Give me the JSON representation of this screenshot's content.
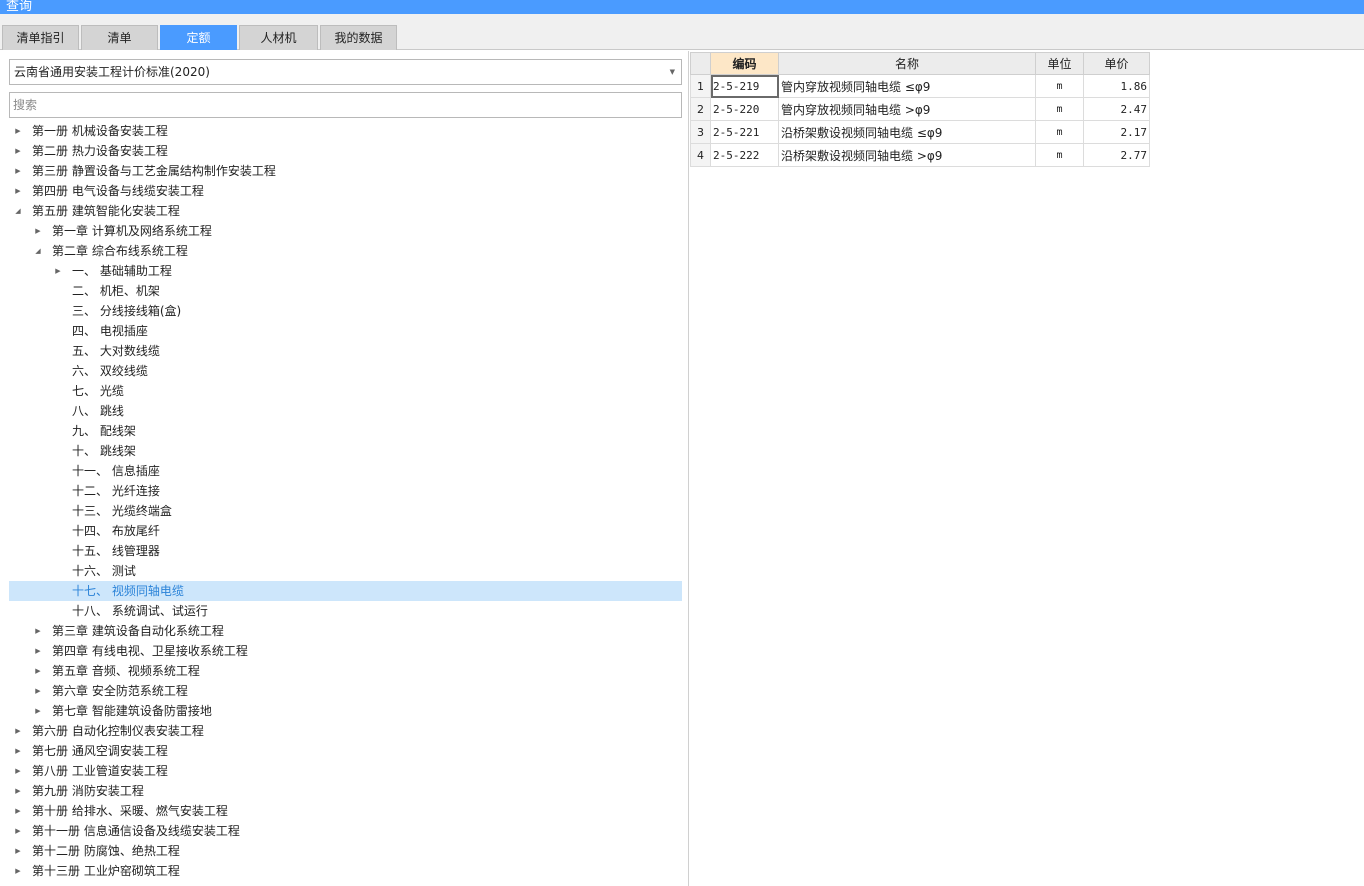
{
  "window": {
    "title": "查询"
  },
  "tabs": [
    {
      "label": "清单指引"
    },
    {
      "label": "清单"
    },
    {
      "label": "定额",
      "active": true
    },
    {
      "label": "人材机"
    },
    {
      "label": "我的数据"
    }
  ],
  "left_panel": {
    "standard_select": {
      "value": "云南省通用安装工程计价标准(2020)"
    },
    "search": {
      "placeholder": "搜索"
    },
    "tree": [
      {
        "label": "第一册 机械设备安装工程",
        "level": 0,
        "state": "collapsed"
      },
      {
        "label": "第二册 热力设备安装工程",
        "level": 0,
        "state": "collapsed"
      },
      {
        "label": "第三册 静置设备与工艺金属结构制作安装工程",
        "level": 0,
        "state": "collapsed"
      },
      {
        "label": "第四册 电气设备与线缆安装工程",
        "level": 0,
        "state": "collapsed"
      },
      {
        "label": "第五册 建筑智能化安装工程",
        "level": 0,
        "state": "expanded"
      },
      {
        "label": "第一章 计算机及网络系统工程",
        "level": 1,
        "state": "collapsed"
      },
      {
        "label": "第二章 综合布线系统工程",
        "level": 1,
        "state": "expanded"
      },
      {
        "label": "一、 基础辅助工程",
        "level": 2,
        "state": "collapsed"
      },
      {
        "label": "二、 机柜、机架",
        "level": 2,
        "state": "leaf"
      },
      {
        "label": "三、 分线接线箱(盒)",
        "level": 2,
        "state": "leaf"
      },
      {
        "label": "四、 电视插座",
        "level": 2,
        "state": "leaf"
      },
      {
        "label": "五、 大对数线缆",
        "level": 2,
        "state": "leaf"
      },
      {
        "label": "六、 双绞线缆",
        "level": 2,
        "state": "leaf"
      },
      {
        "label": "七、 光缆",
        "level": 2,
        "state": "leaf"
      },
      {
        "label": "八、 跳线",
        "level": 2,
        "state": "leaf"
      },
      {
        "label": "九、 配线架",
        "level": 2,
        "state": "leaf"
      },
      {
        "label": "十、 跳线架",
        "level": 2,
        "state": "leaf"
      },
      {
        "label": "十一、 信息插座",
        "level": 2,
        "state": "leaf"
      },
      {
        "label": "十二、 光纤连接",
        "level": 2,
        "state": "leaf"
      },
      {
        "label": "十三、 光缆终端盒",
        "level": 2,
        "state": "leaf"
      },
      {
        "label": "十四、 布放尾纤",
        "level": 2,
        "state": "leaf"
      },
      {
        "label": "十五、 线管理器",
        "level": 2,
        "state": "leaf"
      },
      {
        "label": "十六、 测试",
        "level": 2,
        "state": "leaf"
      },
      {
        "label": "十七、 视频同轴电缆",
        "level": 2,
        "state": "leaf",
        "selected": true
      },
      {
        "label": "十八、 系统调试、试运行",
        "level": 2,
        "state": "leaf"
      },
      {
        "label": "第三章 建筑设备自动化系统工程",
        "level": 1,
        "state": "collapsed"
      },
      {
        "label": "第四章 有线电视、卫星接收系统工程",
        "level": 1,
        "state": "collapsed"
      },
      {
        "label": "第五章 音频、视频系统工程",
        "level": 1,
        "state": "collapsed"
      },
      {
        "label": "第六章 安全防范系统工程",
        "level": 1,
        "state": "collapsed"
      },
      {
        "label": "第七章 智能建筑设备防雷接地",
        "level": 1,
        "state": "collapsed"
      },
      {
        "label": "第六册 自动化控制仪表安装工程",
        "level": 0,
        "state": "collapsed"
      },
      {
        "label": "第七册 通风空调安装工程",
        "level": 0,
        "state": "collapsed"
      },
      {
        "label": "第八册 工业管道安装工程",
        "level": 0,
        "state": "collapsed"
      },
      {
        "label": "第九册 消防安装工程",
        "level": 0,
        "state": "collapsed"
      },
      {
        "label": "第十册 给排水、采暖、燃气安装工程",
        "level": 0,
        "state": "collapsed"
      },
      {
        "label": "第十一册 信息通信设备及线缆安装工程",
        "level": 0,
        "state": "collapsed"
      },
      {
        "label": "第十二册 防腐蚀、绝热工程",
        "level": 0,
        "state": "collapsed"
      },
      {
        "label": "第十三册 工业炉窑砌筑工程",
        "level": 0,
        "state": "collapsed"
      }
    ]
  },
  "grid": {
    "columns": {
      "code": "编码",
      "name": "名称",
      "unit": "单位",
      "price": "单价"
    },
    "rows": [
      {
        "index": "1",
        "code": "2-5-219",
        "name": "管内穿放视频同轴电缆 ≤φ9",
        "unit": "m",
        "price": "1.86"
      },
      {
        "index": "2",
        "code": "2-5-220",
        "name": "管内穿放视频同轴电缆 >φ9",
        "unit": "m",
        "price": "2.47"
      },
      {
        "index": "3",
        "code": "2-5-221",
        "name": "沿桥架敷设视频同轴电缆 ≤φ9",
        "unit": "m",
        "price": "2.17"
      },
      {
        "index": "4",
        "code": "2-5-222",
        "name": "沿桥架敷设视频同轴电缆 >φ9",
        "unit": "m",
        "price": "2.77"
      }
    ]
  }
}
